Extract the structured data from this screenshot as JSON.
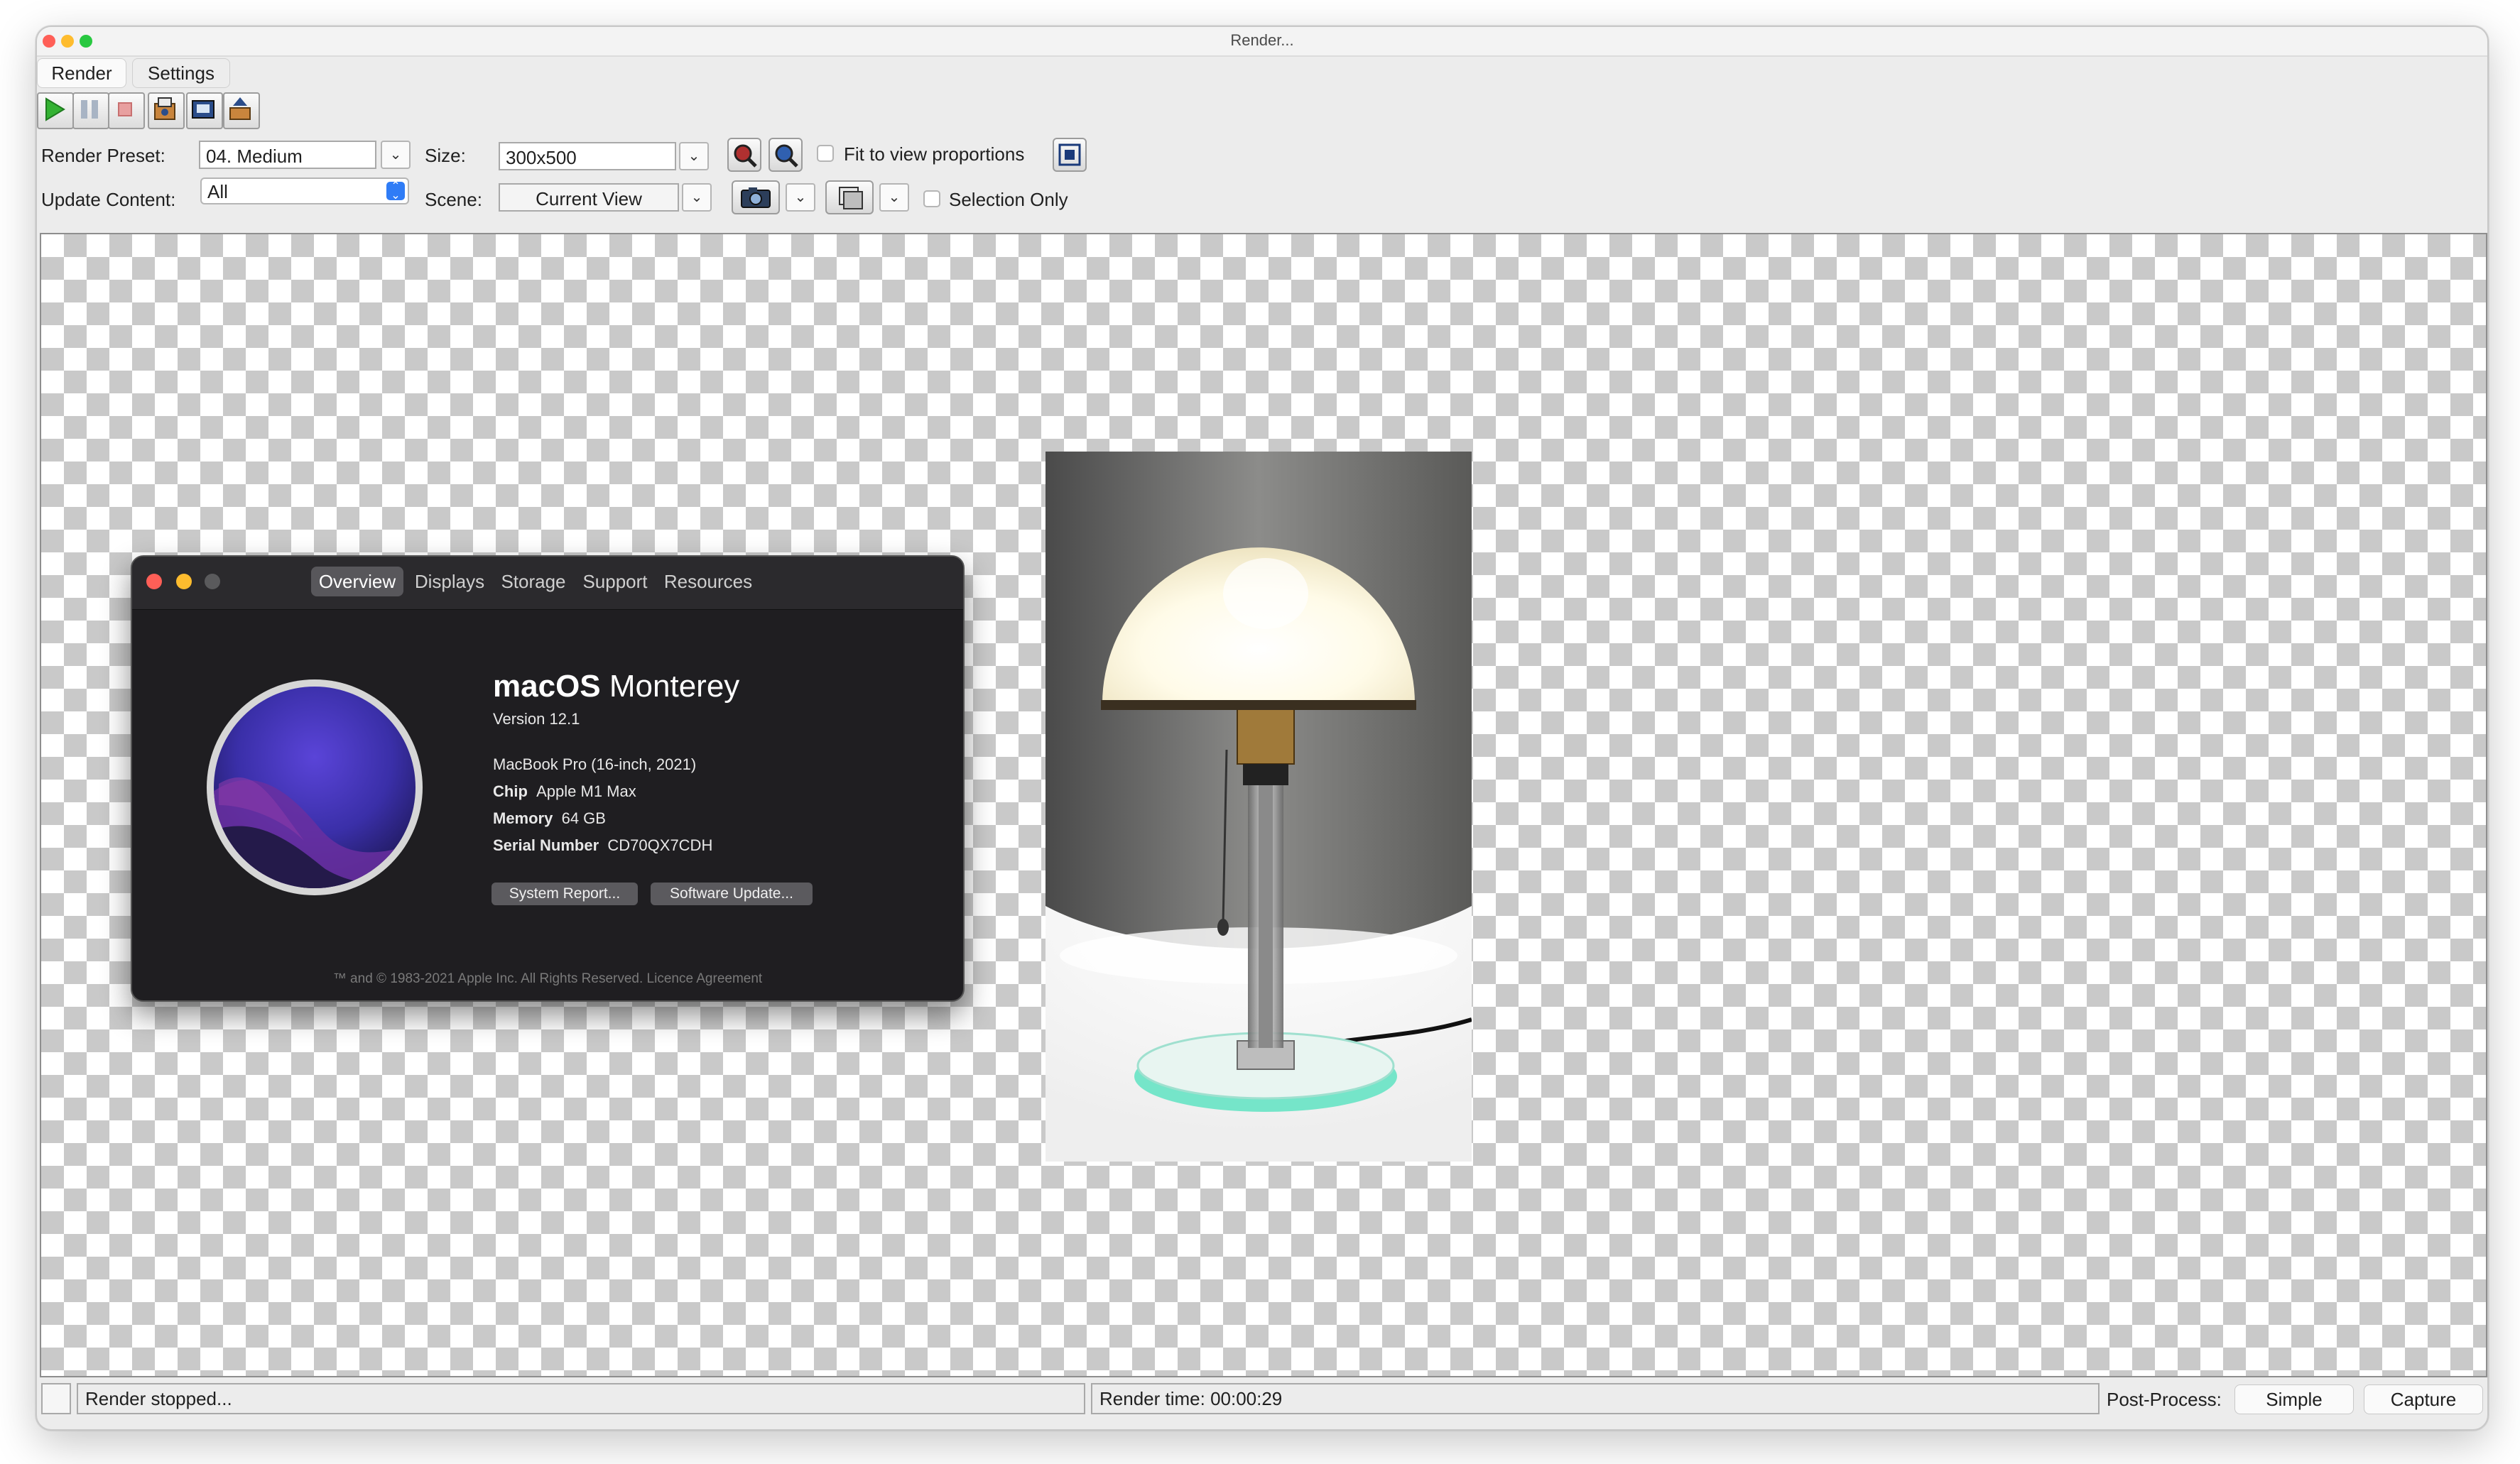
{
  "window": {
    "title": "Render..."
  },
  "tabs": [
    {
      "label": "Render"
    },
    {
      "label": "Settings"
    }
  ],
  "toolbar": {
    "buttons": [
      {
        "name": "start-render-icon"
      },
      {
        "name": "pause-render-icon"
      },
      {
        "name": "stop-render-icon"
      },
      {
        "name": "save-image-icon"
      },
      {
        "name": "copy-image-icon"
      },
      {
        "name": "export-image-icon"
      }
    ]
  },
  "settings": {
    "render_preset_label": "Render Preset:",
    "render_preset_value": "04. Medium",
    "size_label": "Size:",
    "size_value": "300x500",
    "fit_to_view_label": "Fit to view proportions",
    "update_content_label": "Update Content:",
    "update_content_value": "All",
    "scene_label": "Scene:",
    "scene_value": "Current View",
    "selection_only_label": "Selection Only"
  },
  "about_window": {
    "tabs": [
      "Overview",
      "Displays",
      "Storage",
      "Support",
      "Resources"
    ],
    "active_tab": "Overview",
    "os_name_bold": "macOS",
    "os_name_light": "Monterey",
    "version": "Version 12.1",
    "model": "MacBook Pro (16-inch, 2021)",
    "chip_label": "Chip",
    "chip_value": "Apple M1 Max",
    "memory_label": "Memory",
    "memory_value": "64 GB",
    "serial_label": "Serial Number",
    "serial_value": "CD70QX7CDH",
    "system_report_button": "System Report...",
    "software_update_button": "Software Update...",
    "footer": "™ and © 1983-2021 Apple Inc. All Rights Reserved. Licence Agreement"
  },
  "status": {
    "message": "Render stopped...",
    "render_time": "Render time: 00:00:29",
    "post_process_label": "Post-Process:",
    "simple_button": "Simple",
    "capture_button": "Capture"
  },
  "colors": {
    "window_bg": "#ececec",
    "about_bg": "#1f1e21",
    "close": "#ff5f57",
    "minimize": "#febc2e",
    "zoom": "#28c840"
  }
}
